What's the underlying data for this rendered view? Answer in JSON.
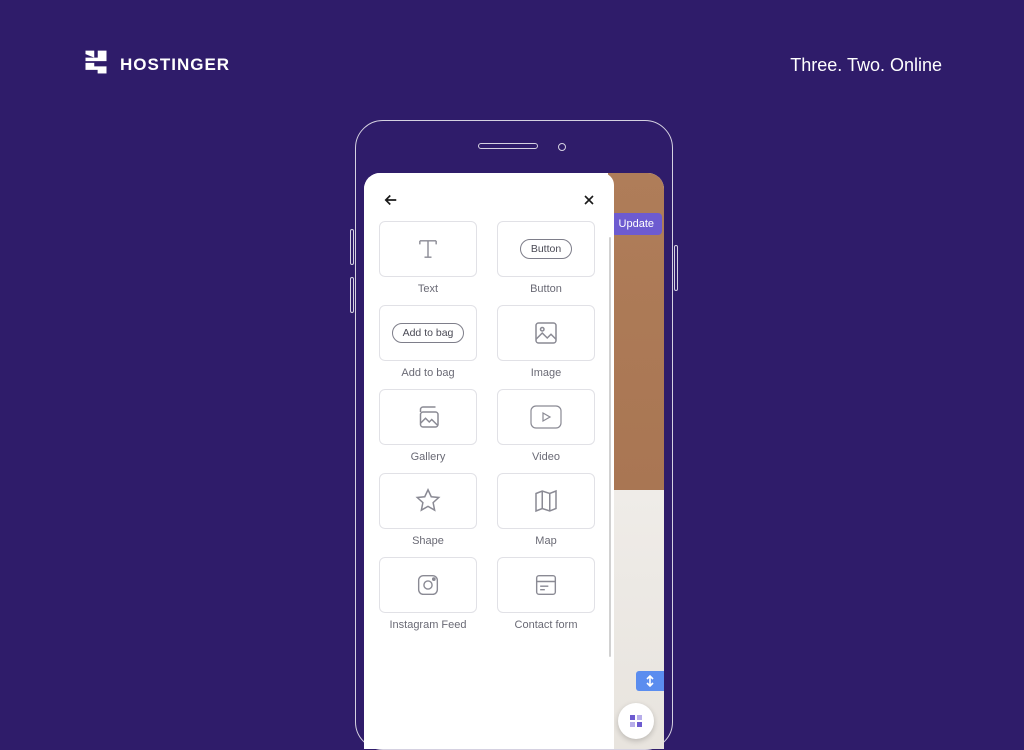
{
  "header": {
    "brand": "HOSTINGER",
    "tagline": "Three. Two. Online"
  },
  "background_app": {
    "primary_button": "Update"
  },
  "elements_panel": {
    "items": [
      {
        "label": "Text",
        "pill_text": null,
        "icon": "text"
      },
      {
        "label": "Button",
        "pill_text": "Button",
        "icon": "pill"
      },
      {
        "label": "Add to bag",
        "pill_text": "Add to bag",
        "icon": "pill"
      },
      {
        "label": "Image",
        "pill_text": null,
        "icon": "image"
      },
      {
        "label": "Gallery",
        "pill_text": null,
        "icon": "gallery"
      },
      {
        "label": "Video",
        "pill_text": null,
        "icon": "video"
      },
      {
        "label": "Shape",
        "pill_text": null,
        "icon": "shape"
      },
      {
        "label": "Map",
        "pill_text": null,
        "icon": "map"
      },
      {
        "label": "Instagram Feed",
        "pill_text": null,
        "icon": "instagram"
      },
      {
        "label": "Contact form",
        "pill_text": null,
        "icon": "form"
      }
    ]
  }
}
